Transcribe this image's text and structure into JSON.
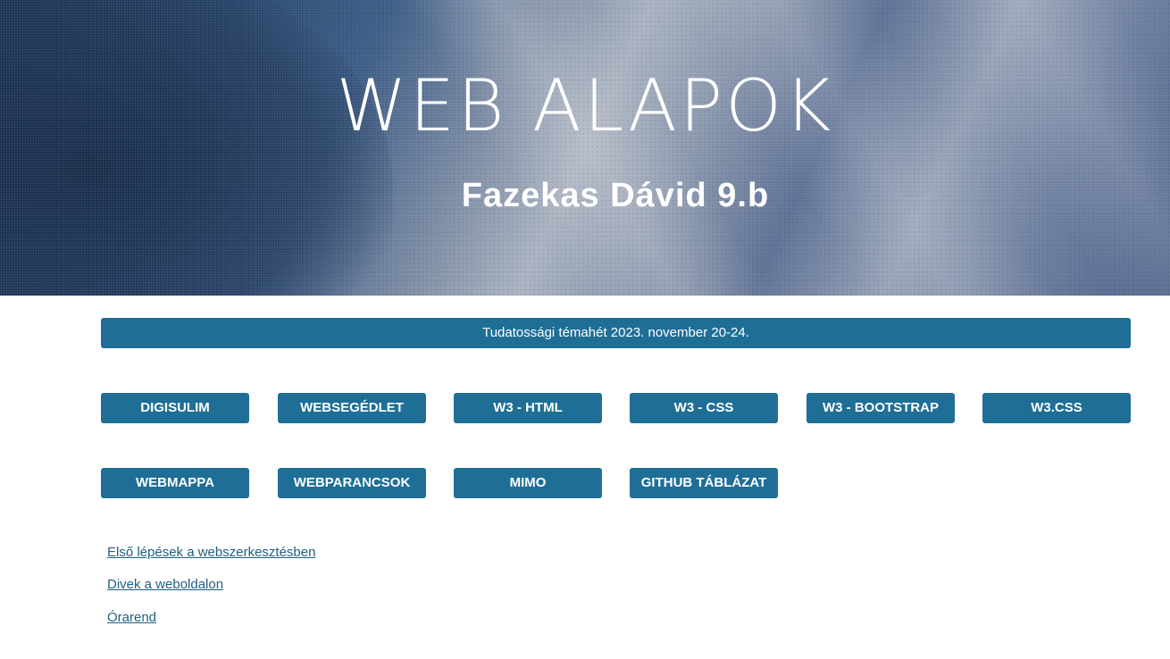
{
  "header": {
    "title": "WEB ALAPOK",
    "subtitle": "Fazekas Dávid 9.b"
  },
  "notice": {
    "text": "Tudatossági témahét 2023. november 20-24."
  },
  "buttons": [
    {
      "label": "DIGISULIM"
    },
    {
      "label": "WEBSEGÉDLET"
    },
    {
      "label": "W3 - HTML"
    },
    {
      "label": "W3 - CSS"
    },
    {
      "label": "W3 - BOOTSTRAP"
    },
    {
      "label": "W3.CSS"
    },
    {
      "label": "WEBMAPPA"
    },
    {
      "label": "WEBPARANCSOK"
    },
    {
      "label": "MIMO"
    },
    {
      "label": "GITHUB TÁBLÁZAT"
    }
  ],
  "links": [
    {
      "label": "Első lépések a webszerkesztésben"
    },
    {
      "label": "Divek a weboldalon"
    },
    {
      "label": "Órarend"
    }
  ],
  "colors": {
    "accent": "#1f6e96",
    "link": "#1f5f80",
    "hero_text": "#ffffff"
  }
}
